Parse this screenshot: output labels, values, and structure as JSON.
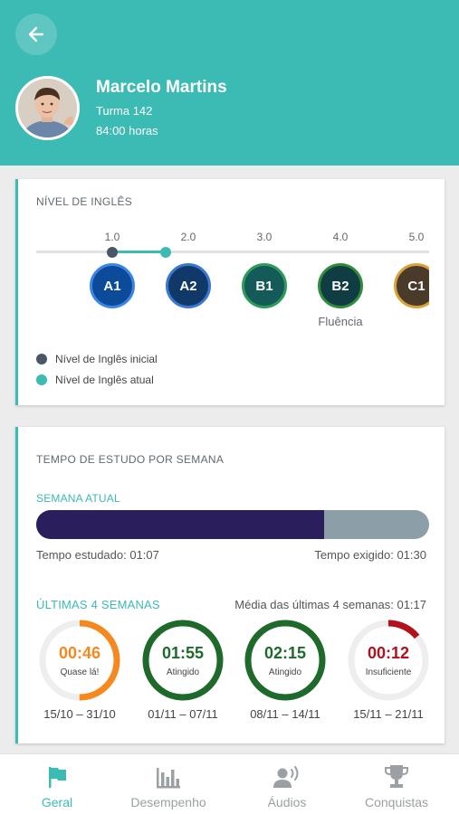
{
  "header": {
    "name": "Marcelo Martins",
    "class_label": "Turma 142",
    "hours": "84:00 horas",
    "accent": "#3cbab4"
  },
  "english_level": {
    "title": "NÍVEL DE INGLÊS",
    "ticks": [
      "1.0",
      "2.0",
      "3.0",
      "4.0",
      "5.0"
    ],
    "initial_level": 1.0,
    "current_level": 1.7,
    "badges": [
      {
        "label": "A1",
        "color": "#0c4a9a",
        "ring": "#3e86e6"
      },
      {
        "label": "A2",
        "color": "#103868",
        "ring": "#3a78d0"
      },
      {
        "label": "B1",
        "color": "#135a58",
        "ring": "#2e9b5a"
      },
      {
        "label": "B2",
        "color": "#0f3d43",
        "ring": "#2e8c3a"
      },
      {
        "label": "C1",
        "color": "#4a3a2a",
        "ring": "#d9a23a"
      }
    ],
    "fluency_label": "Fluência",
    "legend": {
      "initial": "Nível de Inglês inicial",
      "current": "Nível de Inglês atual"
    }
  },
  "study_time": {
    "title": "TEMPO DE ESTUDO POR SEMANA",
    "current_week_label": "SEMANA ATUAL",
    "progress_fraction": 0.733,
    "studied": "Tempo estudado: 01:07",
    "required": "Tempo exigido: 01:30",
    "last_weeks_label": "ÚLTIMAS 4 SEMANAS",
    "average": "Média das últimas 4 semanas: 01:17",
    "weeks": [
      {
        "time": "00:46",
        "status": "Quase lá!",
        "dates": "15/10 – 31/10",
        "fraction": 0.5,
        "color": "#f5891f"
      },
      {
        "time": "01:55",
        "status": "Atingido",
        "dates": "01/11 – 07/11",
        "fraction": 1.0,
        "color": "#1d6a2b"
      },
      {
        "time": "02:15",
        "status": "Atingido",
        "dates": "08/11 – 14/11",
        "fraction": 1.0,
        "color": "#1d6a2b"
      },
      {
        "time": "00:12",
        "status": "Insuficiente",
        "dates": "15/11 – 21/11",
        "fraction": 0.14,
        "color": "#b3121b"
      }
    ]
  },
  "tabs": [
    {
      "label": "Geral",
      "icon": "flag-icon",
      "active": true
    },
    {
      "label": "Desempenho",
      "icon": "bar-chart-icon",
      "active": false
    },
    {
      "label": "Áudios",
      "icon": "speaker-person-icon",
      "active": false
    },
    {
      "label": "Conquistas",
      "icon": "trophy-icon",
      "active": false
    }
  ]
}
